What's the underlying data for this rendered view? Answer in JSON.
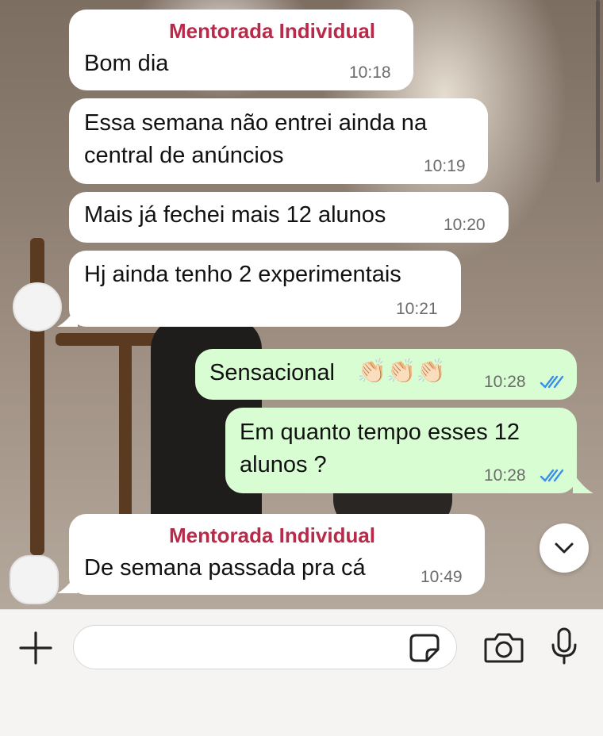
{
  "messages": [
    {
      "sender": "Mentorada Individual",
      "text_lines": [
        "Bom dia"
      ],
      "time": "10:18"
    },
    {
      "text_lines": [
        "Essa semana não entrei ainda na",
        "central de anúncios"
      ],
      "time": "10:19"
    },
    {
      "text_lines": [
        "Mais já fechei mais 12 alunos"
      ],
      "time": "10:20"
    },
    {
      "text_lines": [
        "Hj ainda tenho 2 experimentais"
      ],
      "time": "10:21"
    },
    {
      "text_lines": [
        "Sensacional"
      ],
      "emoji": "👏🏻👏🏻👏🏻",
      "time": "10:28",
      "status": "read"
    },
    {
      "text_lines": [
        "Em quanto tempo esses 12",
        "alunos ?"
      ],
      "time": "10:28",
      "status": "read"
    },
    {
      "sender": "Mentorada Individual",
      "text_lines": [
        "De semana passada pra cá"
      ],
      "time": "10:49"
    }
  ],
  "colors": {
    "incoming_bubble": "#ffffff",
    "outgoing_bubble": "#d9fdd3",
    "sender_name": "#b8294a",
    "read_ticks": "#3b8fe8"
  },
  "icons": {
    "attach": "plus-icon",
    "sticker": "sticker-icon",
    "camera": "camera-icon",
    "mic": "microphone-icon",
    "scroll": "chevron-down-icon"
  },
  "composer": {
    "value": ""
  }
}
